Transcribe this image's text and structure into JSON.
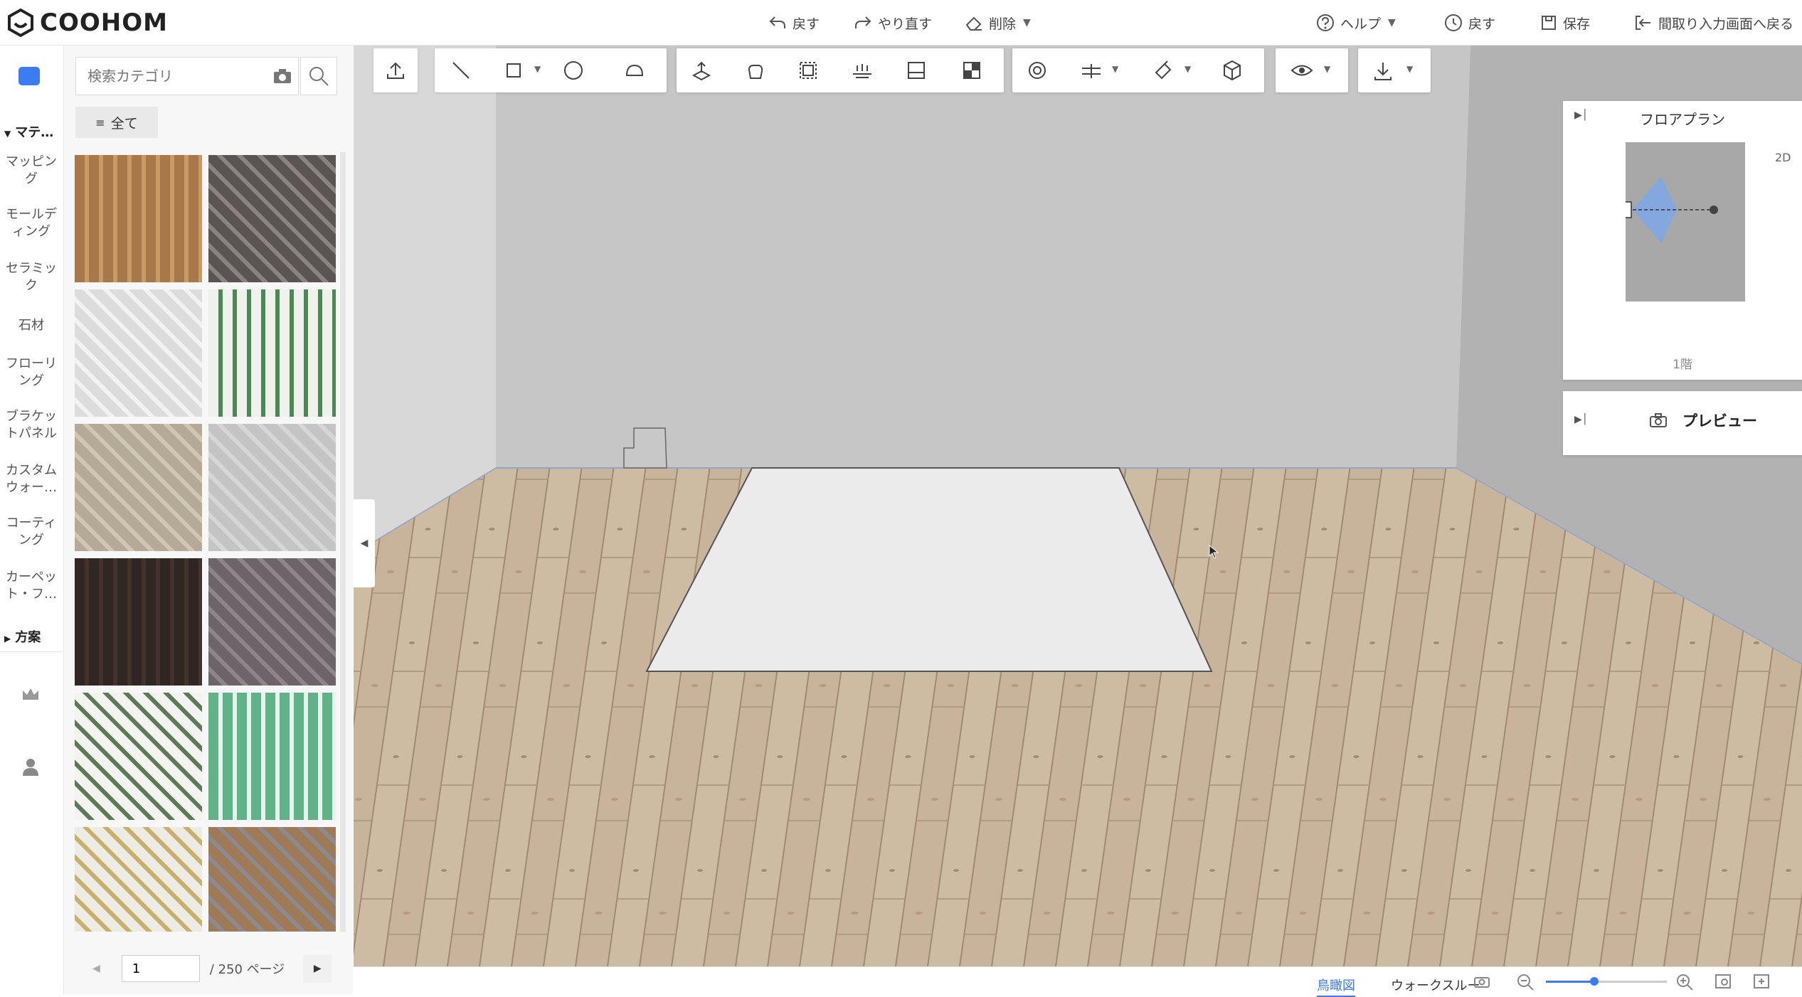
{
  "app": {
    "logo_text": "COOHOM"
  },
  "toolbar": {
    "undo_label": "戻す",
    "redo_label": "やり直す",
    "delete_label": "削除",
    "help_label": "ヘルプ",
    "history_label": "戻す",
    "save_label": "保存",
    "back_to_floorplan_label": "間取り入力画面へ戻る"
  },
  "sidebar": {
    "section_material": "マテ…",
    "categories": [
      "マッピング",
      "モールディング",
      "セラミック",
      "石材",
      "フローリング",
      "ブラケットパネル",
      "カスタムウォー…",
      "コーティング",
      "カーペット・フ…"
    ],
    "section_plan": "方案"
  },
  "search": {
    "placeholder": "検索カテゴリ"
  },
  "filter": {
    "label": "全て"
  },
  "materials": [
    {
      "name": "wood-light",
      "colors": [
        "#a8784a",
        "#c99a62"
      ]
    },
    {
      "name": "wood-gray",
      "colors": [
        "#5a5552",
        "#8a8380"
      ]
    },
    {
      "name": "marble-white",
      "colors": [
        "#dcdcdc",
        "#f2f2f2"
      ]
    },
    {
      "name": "leaf-pattern",
      "colors": [
        "#f0f0ec",
        "#4b8a55"
      ]
    },
    {
      "name": "concrete-beige",
      "colors": [
        "#b5aa98",
        "#cfc6b6"
      ]
    },
    {
      "name": "tile-gray",
      "colors": [
        "#c4c4c4",
        "#d6d6d6"
      ]
    },
    {
      "name": "dark-stone",
      "colors": [
        "#302622",
        "#41332c"
      ]
    },
    {
      "name": "granite-gray",
      "colors": [
        "#6c6468",
        "#8e8589"
      ]
    },
    {
      "name": "leaf-white",
      "colors": [
        "#f3f3ef",
        "#5c7a55"
      ]
    },
    {
      "name": "geometric-green",
      "colors": [
        "#5fb389",
        "#e8f2ea"
      ]
    },
    {
      "name": "floral-hexagon",
      "colors": [
        "#ecebe4",
        "#c8b06a"
      ]
    },
    {
      "name": "carpet-patch",
      "colors": [
        "#9e7a56",
        "#8c8990"
      ]
    }
  ],
  "pagination": {
    "current_page": "1",
    "total_label": "/ 250 ページ"
  },
  "floorplan": {
    "title": "フロアプラン",
    "mode": "2D",
    "floor_label": "1階"
  },
  "preview": {
    "title": "プレビュー"
  },
  "view_modes": {
    "birdseye": "鳥瞰図",
    "walkthrough": "ウォークスルー"
  },
  "zoom": {
    "level": 0.4
  },
  "colors": {
    "accent": "#3b7cf0",
    "floor": "#c7b49b",
    "rug": "#ebebeb",
    "wall_back": "#c6c6c6"
  }
}
